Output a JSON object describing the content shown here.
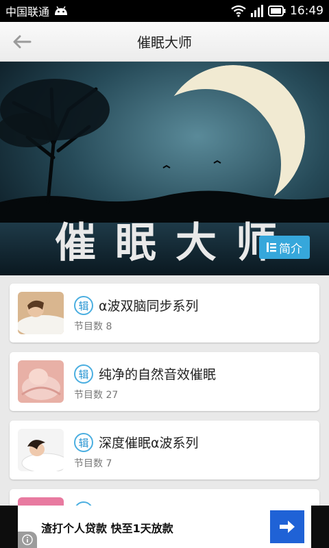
{
  "status_bar": {
    "carrier": "中国联通",
    "time": "16:49"
  },
  "header": {
    "title": "催眠大师"
  },
  "banner": {
    "title_art": "催眠大师",
    "intro_label": "简介"
  },
  "albums": [
    {
      "badge": "辑",
      "title": "α波双脑同步系列",
      "count": "节目数 8"
    },
    {
      "badge": "辑",
      "title": "纯净的自然音效催眠",
      "count": "节目数 27"
    },
    {
      "badge": "辑",
      "title": "深度催眠α波系列",
      "count": "节目数 7"
    },
    {
      "badge": "辑",
      "title": "",
      "count": ""
    }
  ],
  "ad": {
    "text": "渣打个人贷款 快至1天放款",
    "arrow_icon": "arrow-right-icon",
    "info_icon": "info-icon"
  },
  "colors": {
    "accent": "#36a7db",
    "ad_button": "#1f62d6"
  }
}
